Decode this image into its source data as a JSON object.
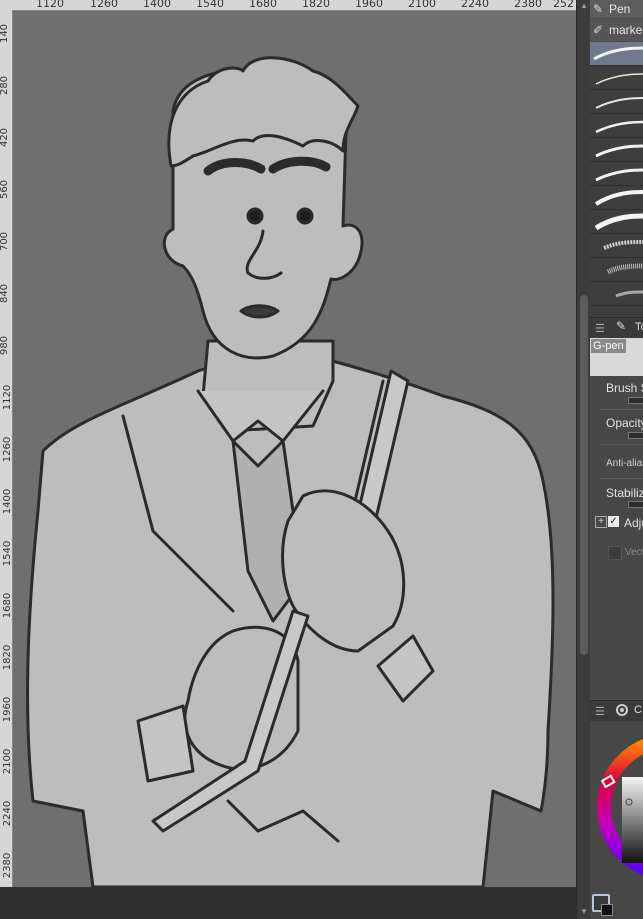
{
  "ruler": {
    "top_ticks": [
      "1120",
      "1260",
      "1400",
      "1540",
      "1680",
      "1820",
      "1960",
      "2100",
      "2240",
      "2380",
      "252"
    ],
    "left_ticks": [
      "140",
      "280",
      "420",
      "560",
      "700",
      "840",
      "980",
      "1120",
      "1260",
      "1400",
      "1540",
      "1680",
      "1820",
      "1960",
      "2100",
      "2240",
      "2380"
    ]
  },
  "panel": {
    "tab_pen": {
      "label": "Pen",
      "icon": "pen-icon"
    },
    "tab_marker": {
      "label": "marke",
      "icon": "marker-icon"
    },
    "brushes": [
      "G-pen brush stroke",
      "brush stroke 2",
      "brush stroke 3",
      "brush stroke 4",
      "brush stroke 5",
      "brush stroke 6",
      "brush stroke 7",
      "brush stroke 8",
      "brush stroke 9",
      "brush stroke 10",
      "brush stroke 11"
    ],
    "tool_property": {
      "tab_label": "To",
      "subtool_name": "G-pen",
      "brush_size_label": "Brush S",
      "opacity_label": "Opacity",
      "anti_alias_label": "Anti-alias",
      "stabilization_label": "Stabiliza",
      "adjust_label": "Adju",
      "vector_label": "Vecto"
    },
    "color": {
      "tab_label": "C",
      "accent": "#e0003a"
    }
  },
  "colors": {
    "canvas_bg": "#6f6f6f",
    "selected_brush": "#6f7a8e"
  }
}
